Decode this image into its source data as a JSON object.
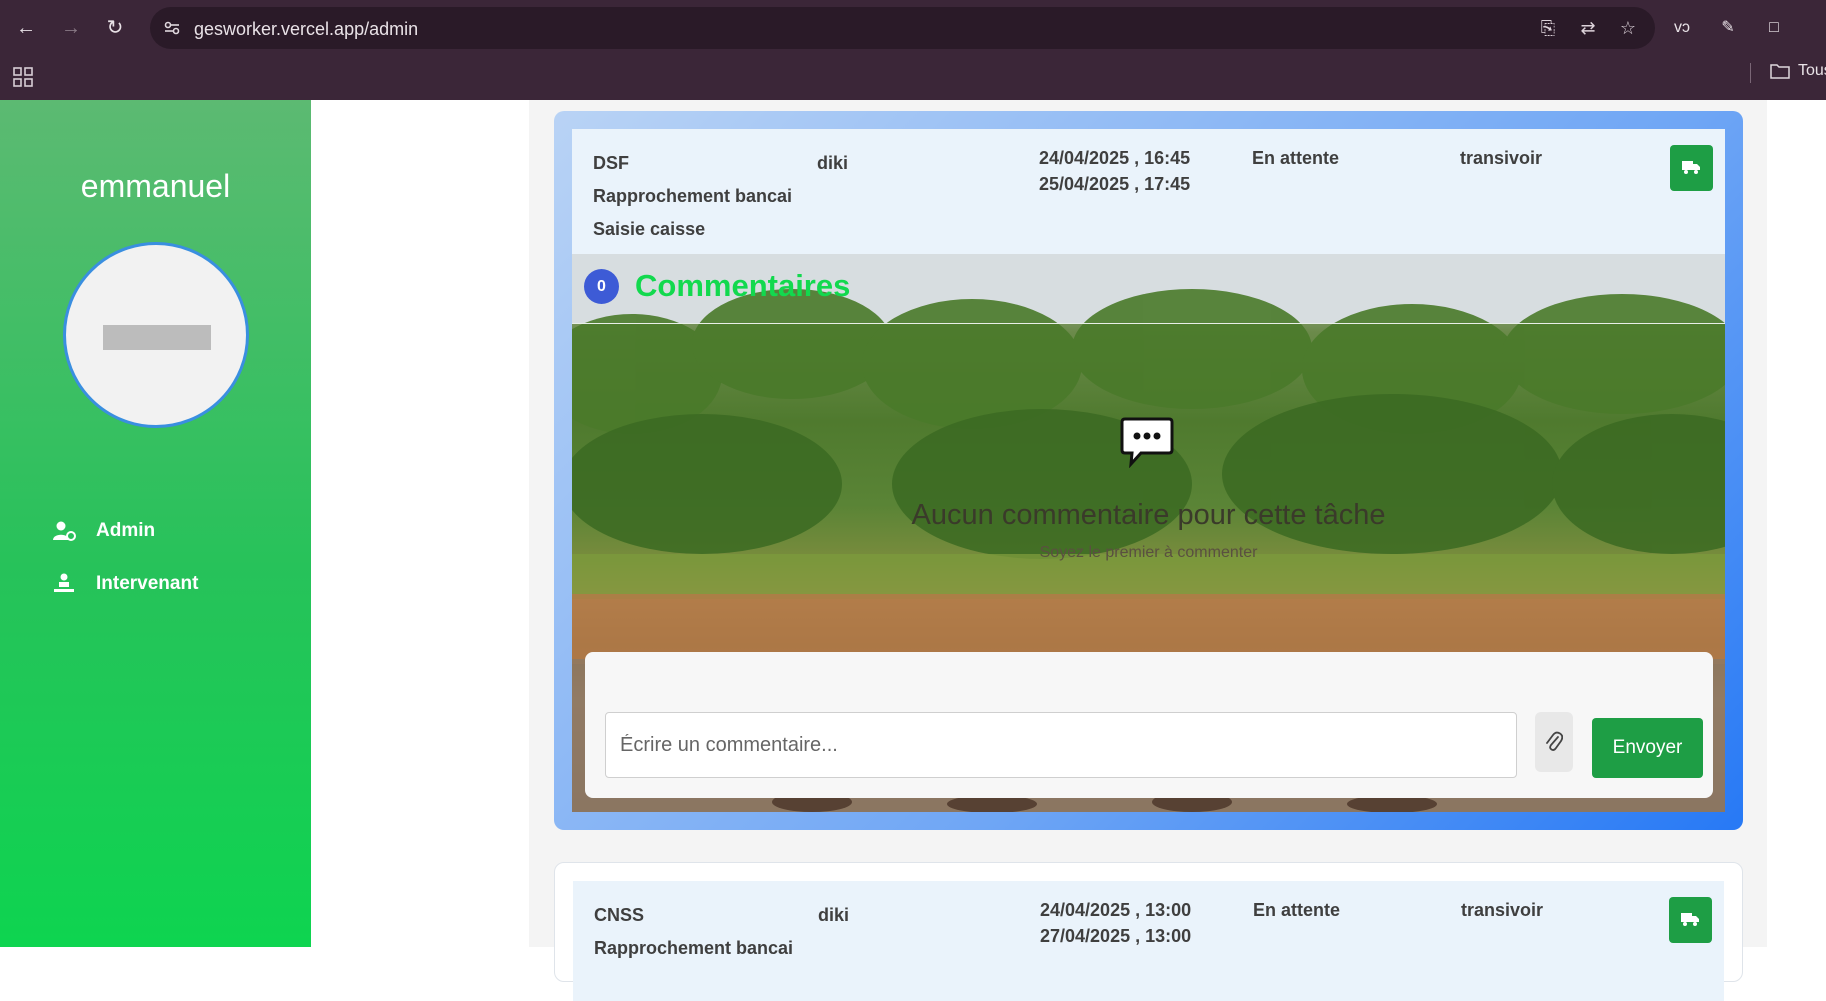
{
  "browser": {
    "url": "gesworker.vercel.app/admin",
    "bookmark_folder": "Tous"
  },
  "sidebar": {
    "user_name": "emmanuel",
    "items": [
      {
        "label": "Admin",
        "icon": "user-settings-icon"
      },
      {
        "label": "Intervenant",
        "icon": "worker-icon"
      }
    ]
  },
  "tasks": [
    {
      "lines": [
        "DSF",
        "Rapprochement bancaire",
        "Saisie caisse"
      ],
      "assignee": "diki",
      "start": "24/04/2025 , 16:45",
      "end": "25/04/2025 , 17:45",
      "status": "En attente",
      "owner": "transivoir"
    },
    {
      "lines": [
        "CNSS",
        "Rapprochement bancaire"
      ],
      "assignee": "diki",
      "start": "24/04/2025 , 13:00",
      "end": "27/04/2025 , 13:00",
      "status": "En attente",
      "owner": "transivoir"
    }
  ],
  "comments": {
    "count": "0",
    "title": "Commentaires",
    "empty_text": "Aucun commentaire pour cette tâche",
    "empty_sub": "Soyez le premier à commenter",
    "input_placeholder": "Écrire un commentaire...",
    "send_label": "Envoyer"
  },
  "colors": {
    "accent_green": "#1e9e45",
    "title_green": "#12d94e",
    "badge_blue": "#3d5bd6"
  }
}
